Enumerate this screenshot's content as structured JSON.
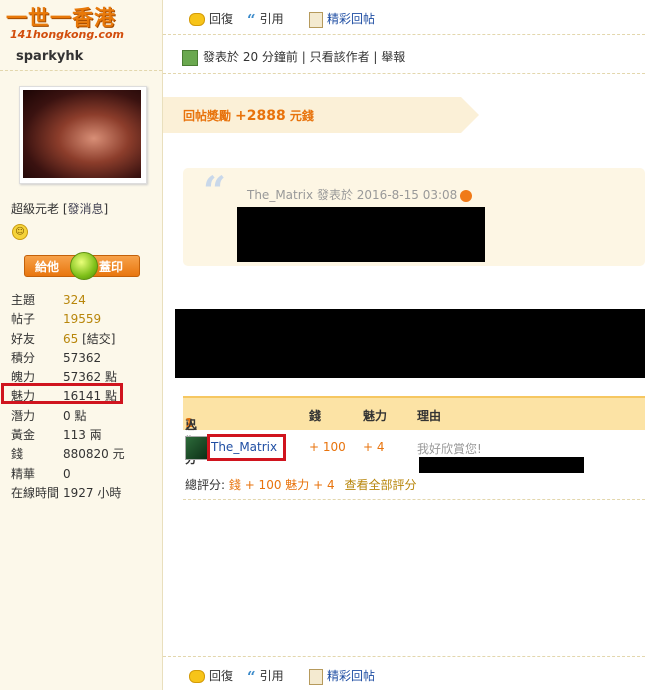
{
  "site": {
    "logo_text": "一世一香港",
    "logo_sub": "141hongkong.com"
  },
  "toolbar": {
    "reply": "回復",
    "quote": "引用",
    "featured_reply": "精彩回帖"
  },
  "user": {
    "name": "sparkyhk",
    "rank": "超級元老",
    "pm_link": "發消息",
    "give_left": "給他",
    "give_right": "蓋印",
    "stats": [
      {
        "key": "主題",
        "value": "324",
        "link": true
      },
      {
        "key": "帖子",
        "value": "19559",
        "link": true
      },
      {
        "key": "好友",
        "value": "65",
        "link": true,
        "extra": "[結交]"
      },
      {
        "key": "積分",
        "value": "57362"
      },
      {
        "key": "魄力",
        "value": "57362 點"
      },
      {
        "key": "魅力",
        "value": "16141 點"
      },
      {
        "key": "潛力",
        "value": "0 點"
      },
      {
        "key": "黃金",
        "value": "113 兩"
      },
      {
        "key": "錢",
        "value": "880820 元"
      },
      {
        "key": "精華",
        "value": "0"
      },
      {
        "key": "在線時間",
        "value": "1927 小時"
      }
    ]
  },
  "post": {
    "meta_posted": "發表於 20 分鐘前",
    "meta_author_only": "只看該作者",
    "meta_report": "舉報",
    "reward_label": "回帖獎勵",
    "reward_amount": "+2888",
    "reward_unit": "元錢",
    "quote_author": "The_Matrix",
    "quote_posted": "發表於",
    "quote_date": "2016-8-15 03:08"
  },
  "rating": {
    "head_prefix": "已有",
    "head_count": "1",
    "head_suffix": "人評分",
    "col_money": "錢",
    "col_charm": "魅力",
    "col_reason": "理由",
    "rater": "The_Matrix",
    "money": "+ 100",
    "charm": "+ 4",
    "reason": "我好欣賞您!",
    "total_label": "總評分:",
    "total_money": "錢 + 100",
    "total_charm": "魅力 + 4",
    "view_all": "查看全部評分"
  }
}
